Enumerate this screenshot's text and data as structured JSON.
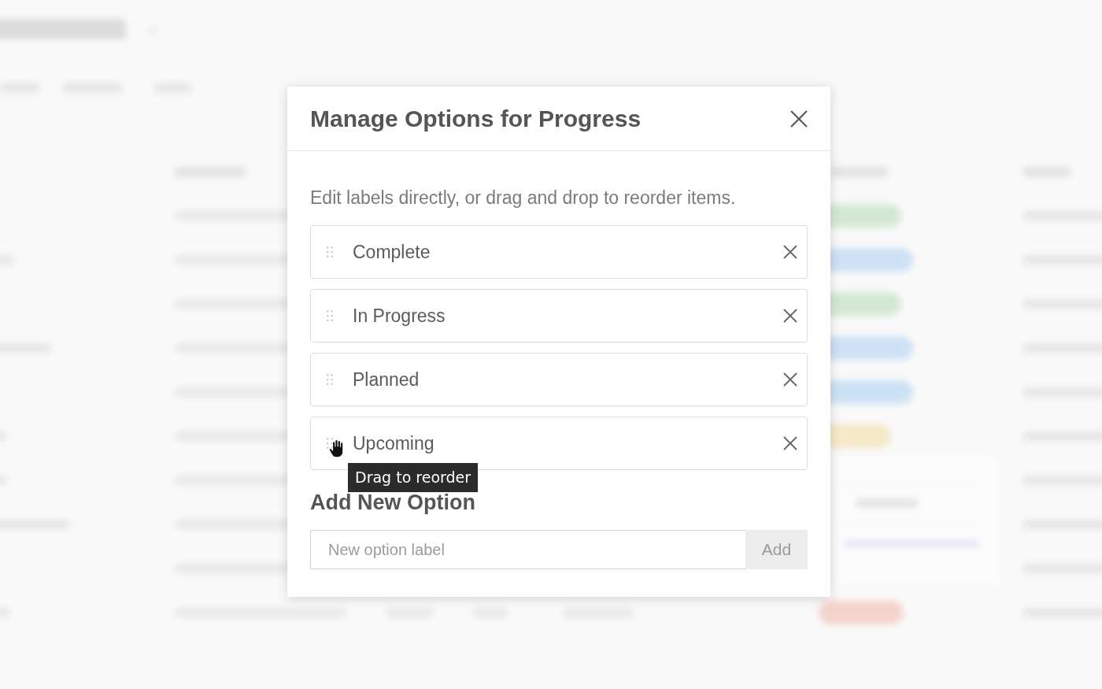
{
  "dialog": {
    "title": "Manage Options for Progress",
    "description": "Edit labels directly, or drag and drop to reorder items.",
    "options": [
      {
        "label": "Complete",
        "hovered": false
      },
      {
        "label": "In Progress",
        "hovered": false
      },
      {
        "label": "Planned",
        "hovered": false
      },
      {
        "label": "Upcoming",
        "hovered": true
      }
    ],
    "drag_tooltip": "Drag to reorder",
    "add_section": {
      "heading": "Add New Option",
      "input": {
        "placeholder": "New option label"
      },
      "add_button": {
        "label": "Add",
        "disabled": true
      }
    }
  }
}
